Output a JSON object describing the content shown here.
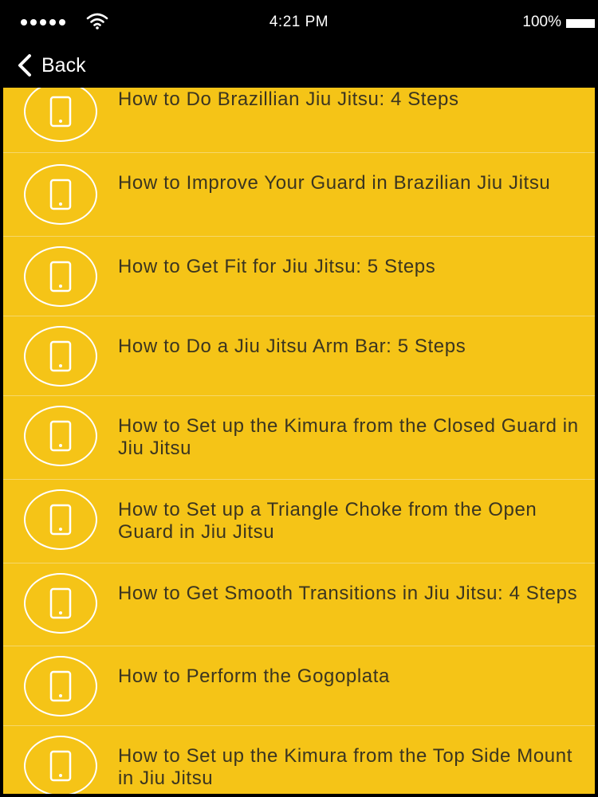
{
  "status_bar": {
    "time": "4:21 PM",
    "battery": "100%",
    "icons": [
      "signal-dots-icon",
      "wifi-icon",
      "battery-icon"
    ]
  },
  "nav": {
    "back_label": "Back",
    "back_icon": "chevron-left-icon"
  },
  "colors": {
    "list_background": "#f5c417",
    "divider": "#f6d76a",
    "text": "#3b3520",
    "icon": "#ffffff",
    "bars": "#000000"
  },
  "list": {
    "item_icon": "phone-icon",
    "items": [
      {
        "title": "How to Do Brazillian Jiu Jitsu: 4 Steps"
      },
      {
        "title": "How to Improve Your Guard in Brazilian Jiu Jitsu"
      },
      {
        "title": "How to Get Fit for Jiu Jitsu: 5 Steps"
      },
      {
        "title": "How to Do a Jiu Jitsu Arm Bar: 5 Steps"
      },
      {
        "title": "How to Set up the Kimura from the Closed Guard in Jiu Jitsu"
      },
      {
        "title": "How to Set up a Triangle Choke from the Open Guard in Jiu Jitsu"
      },
      {
        "title": "How to Get Smooth Transitions in Jiu Jitsu: 4 Steps"
      },
      {
        "title": "How to Perform the Gogoplata"
      },
      {
        "title": "How to Set up the Kimura from the Top Side Mount in Jiu Jitsu"
      }
    ]
  }
}
